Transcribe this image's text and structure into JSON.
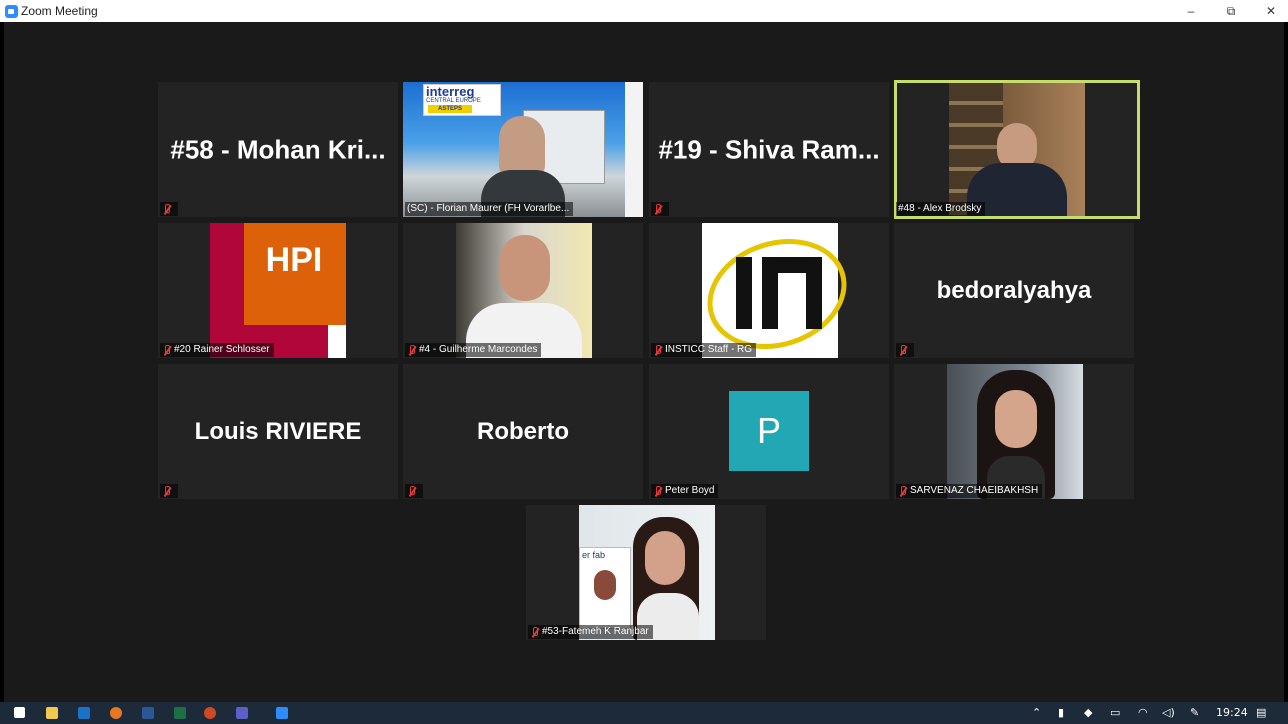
{
  "window": {
    "title": "Zoom Meeting",
    "minimize": "–",
    "restore": "⧉",
    "close": "✕"
  },
  "tiles": [
    {
      "big_text": "#58 - Mohan Kri...",
      "name": ""
    },
    {
      "big_text": "",
      "name": "(SC) - Florian Maurer (FH Vorarlbe...",
      "logo": "interreg",
      "logo_sub": "CENTRAL EUROPE",
      "logo_tag": "ASTEPS"
    },
    {
      "big_text": "#19 - Shiva Ram...",
      "name": ""
    },
    {
      "big_text": "",
      "name": "#48 - Alex Brodsky"
    },
    {
      "big_text": "",
      "name": "#20 Rainer Schlosser",
      "logo": "HPI"
    },
    {
      "big_text": "",
      "name": "#4 - Guilherme Marcondes"
    },
    {
      "big_text": "",
      "name": "INSTICC Staff - RG"
    },
    {
      "big_text": "bedoralyahya",
      "name": ""
    },
    {
      "big_text": "Louis RIVIERE",
      "name": ""
    },
    {
      "big_text": "Roberto",
      "name": ""
    },
    {
      "big_text": "",
      "name": "Peter Boyd",
      "avatar_letter": "P"
    },
    {
      "big_text": "",
      "name": "SARVENAZ CHAEIBAKHSH"
    },
    {
      "big_text": "",
      "name": "#53-Fatemeh K Ranjbar",
      "poster_text": "er fab"
    }
  ],
  "colors": {
    "active_border": "#c6dd6b",
    "muted_mic": "#e23b3b",
    "avatar_bg": "#22a8b4",
    "hpi_red": "#b1063a",
    "hpi_orange": "#dd6108"
  },
  "taskbar": {
    "time": "19:24"
  }
}
